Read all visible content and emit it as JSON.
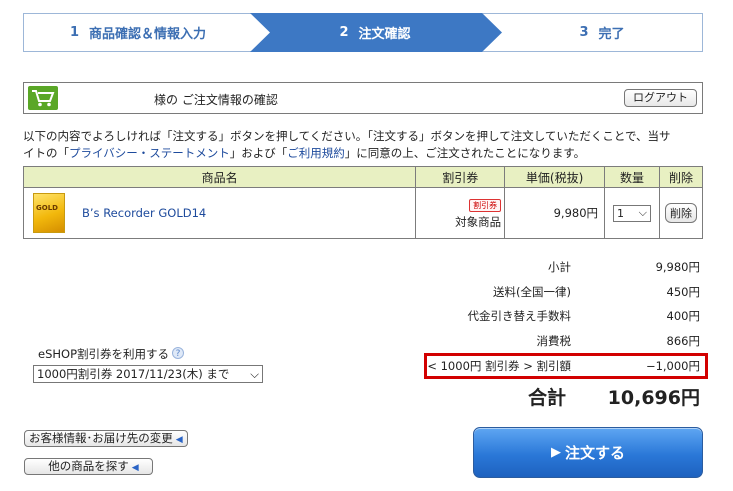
{
  "steps": [
    {
      "num": "1",
      "label": "商品確認＆情報入力"
    },
    {
      "num": "2",
      "label": "注文確認"
    },
    {
      "num": "3",
      "label": "完了"
    }
  ],
  "header": {
    "title": "様の ご注文情報の確認",
    "logout_label": "ログアウト"
  },
  "intro": {
    "line1": "以下の内容でよろしければ「注文する」ボタンを押してください。「注文する」ボタンを押して注文していただくことで、当サ",
    "line2_prefix": "イトの「",
    "privacy_link": "プライバシー・ステートメント",
    "line2_mid": "」および「",
    "terms_link": "ご利用規約",
    "line2_suffix": "」に同意の上、ご注文されたことになります。"
  },
  "table": {
    "headers": {
      "name": "商品名",
      "coupon": "割引券",
      "price": "単価(税抜)",
      "qty": "数量",
      "delete": "削除"
    },
    "rows": [
      {
        "product_image_text": "GOLD",
        "name": "B’s Recorder GOLD14",
        "coupon_badge": "割引券",
        "coupon_label": "対象商品",
        "price": "9,980円",
        "qty": "1",
        "delete_label": "削除"
      }
    ]
  },
  "summary": {
    "subtotal_label": "小計",
    "subtotal": "9,980円",
    "shipping_label": "送料(全国一律)",
    "shipping": "450円",
    "cod_label": "代金引き替え手数料",
    "cod": "400円",
    "tax_label": "消費税",
    "tax": "866円",
    "discount_label": "< 1000円 割引券 > 割引額",
    "discount": "−1,000円",
    "total_label": "合計",
    "total": "10,696円"
  },
  "coupon": {
    "label": "eSHOP割引券を利用する",
    "help": "?",
    "selected": "1000円割引券 2017/11/23(木) まで"
  },
  "buttons": {
    "change_info": "お客様情報･お届け先の変更",
    "other_products": "他の商品を探す",
    "order": "注文する"
  },
  "colors": {
    "step_active": "#3d78c4",
    "accent_blue": "#2a78d8",
    "table_header": "#e8f0c2",
    "discount_border": "#d20000",
    "cart_green": "#5aa727"
  }
}
